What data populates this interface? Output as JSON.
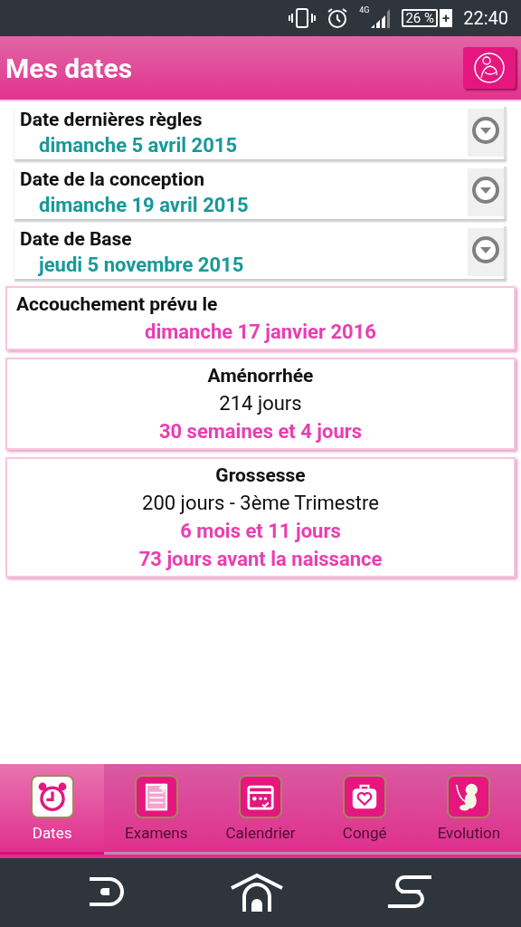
{
  "status_bar": {
    "network": "4G",
    "battery": "26 %",
    "charging": "+",
    "time": "22:40"
  },
  "header": {
    "title": "Mes dates"
  },
  "date_fields": [
    {
      "label": "Date dernières règles",
      "value": "dimanche 5 avril 2015"
    },
    {
      "label": "Date de la conception",
      "value": "dimanche 19 avril 2015"
    },
    {
      "label": "Date de Base",
      "value": "jeudi 5 novembre 2015"
    }
  ],
  "due_date": {
    "label": "Accouchement prévu le",
    "value": "dimanche 17 janvier 2016"
  },
  "cards": [
    {
      "lines": [
        {
          "kind": "title",
          "text": "Aménorrhée"
        },
        {
          "kind": "plain",
          "text": "214 jours"
        },
        {
          "kind": "highlight",
          "text": "30 semaines et 4 jours"
        }
      ]
    },
    {
      "lines": [
        {
          "kind": "title",
          "text": "Grossesse"
        },
        {
          "kind": "plain",
          "text": "200 jours - 3ème Trimestre"
        },
        {
          "kind": "highlight",
          "text": "6 mois et 11 jours"
        },
        {
          "kind": "highlight",
          "text": "73 jours avant la naissance"
        }
      ]
    }
  ],
  "tabs": [
    {
      "kind": "clock",
      "label": "Dates",
      "selected": true
    },
    {
      "kind": "notepad",
      "label": "Examens",
      "selected": false
    },
    {
      "kind": "calendar",
      "label": "Calendrier",
      "selected": false
    },
    {
      "kind": "bag",
      "label": "Congé",
      "selected": false
    },
    {
      "kind": "baby",
      "label": "Evolution",
      "selected": false
    }
  ]
}
